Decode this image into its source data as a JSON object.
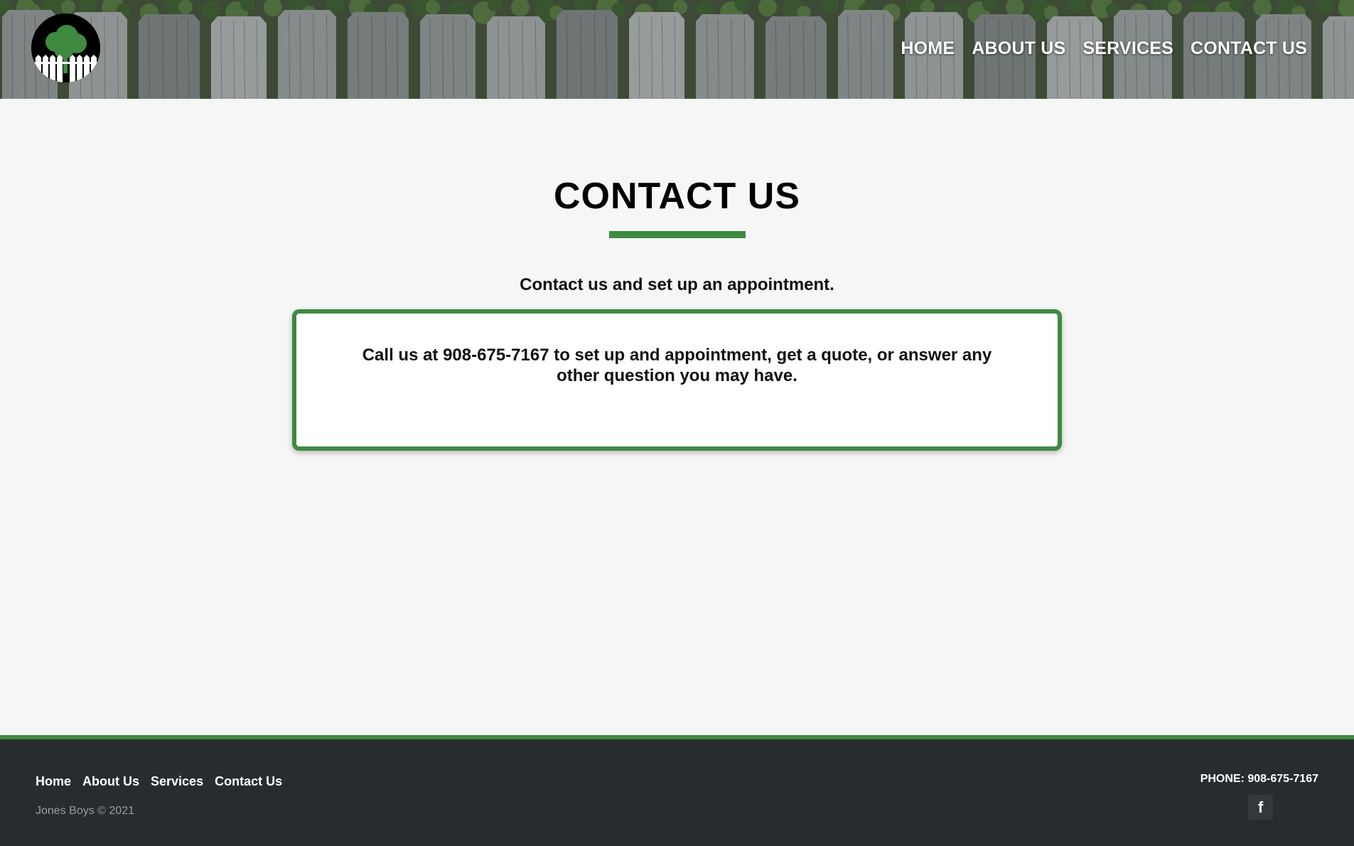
{
  "nav": {
    "items": [
      "HOME",
      "ABOUT US",
      "SERVICES",
      "CONTACT US"
    ]
  },
  "main": {
    "title": "CONTACT US",
    "subtitle": "Contact us and set up an appointment.",
    "card_text": "Call us at 908-675-7167 to set up and appointment, get a quote, or answer any other question you may have."
  },
  "footer": {
    "links": [
      "Home",
      "About Us",
      "Services",
      "Contact Us"
    ],
    "copyright": "Jones Boys © 2021",
    "phone": "PHONE: 908-675-7167",
    "social_icon": "facebook-icon",
    "social_glyph": "f"
  },
  "colors": {
    "accent": "#3f8a41",
    "footer_bg": "#292c2f",
    "page_bg": "#f6f6f6"
  }
}
